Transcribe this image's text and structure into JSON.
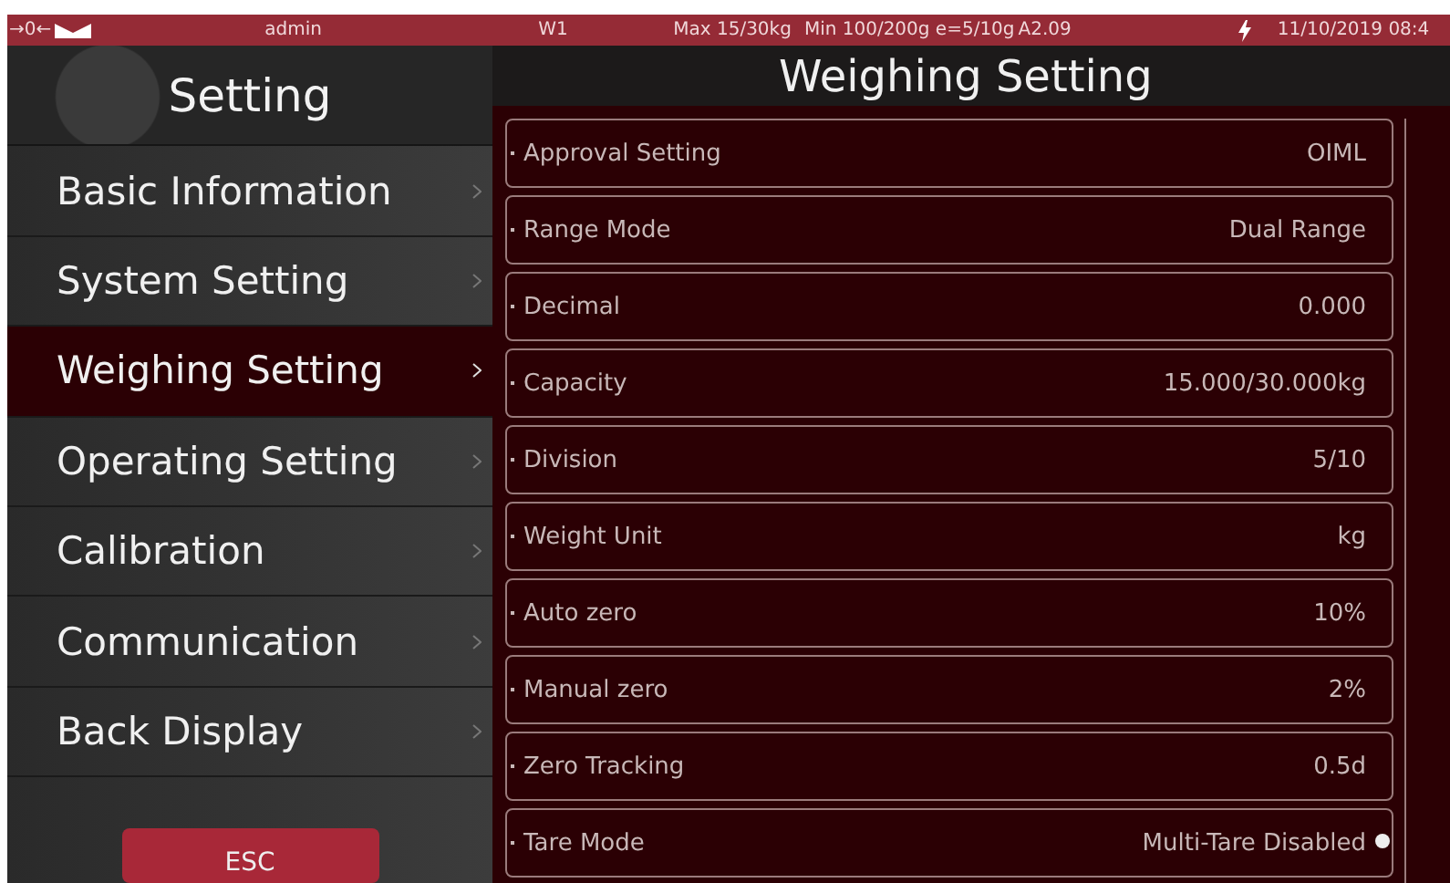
{
  "status_bar": {
    "zero_indicator": "→0←",
    "user": "admin",
    "scale": "W1",
    "max": "Max 15/30kg",
    "min": "Min 100/200g e=5/10g",
    "version": "A2.09",
    "datetime": "11/10/2019 08:4"
  },
  "sidebar": {
    "title": "Setting",
    "items": [
      {
        "label": "Basic Information",
        "selected": false
      },
      {
        "label": "System Setting",
        "selected": false
      },
      {
        "label": "Weighing Setting",
        "selected": true
      },
      {
        "label": "Operating Setting",
        "selected": false
      },
      {
        "label": "Calibration",
        "selected": false
      },
      {
        "label": "Communication",
        "selected": false
      },
      {
        "label": "Back Display",
        "selected": false
      }
    ],
    "esc_button": "ESC"
  },
  "main": {
    "title": "Weighing Setting",
    "rows": [
      {
        "label": "Approval Setting",
        "value": "OIML"
      },
      {
        "label": "Range Mode",
        "value": "Dual Range"
      },
      {
        "label": "Decimal",
        "value": "0.000"
      },
      {
        "label": "Capacity",
        "value": "15.000/30.000kg"
      },
      {
        "label": "Division",
        "value": "5/10"
      },
      {
        "label": "Weight Unit",
        "value": "kg"
      },
      {
        "label": "Auto zero",
        "value": "10%"
      },
      {
        "label": "Manual zero",
        "value": "2%"
      },
      {
        "label": "Zero Tracking",
        "value": "0.5d"
      },
      {
        "label": "Tare Mode",
        "value": "Multi-Tare Disabled"
      }
    ]
  }
}
